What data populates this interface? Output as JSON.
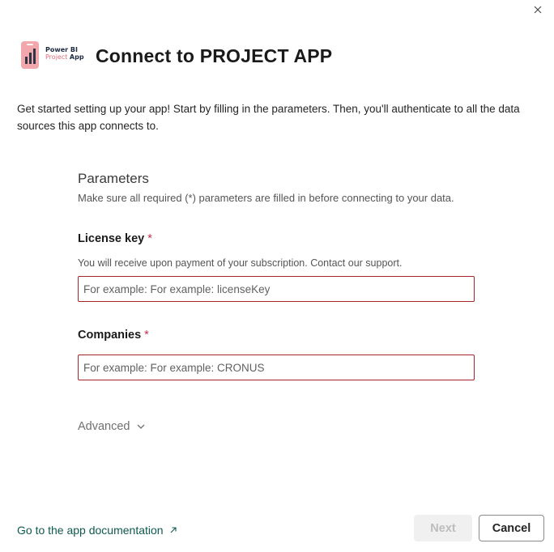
{
  "window": {
    "close_icon": "close-icon"
  },
  "header": {
    "logo_line1": "Power BI",
    "logo_line2_prefix": "Project",
    "logo_line2_suffix": "App",
    "title": "Connect to PROJECT APP"
  },
  "intro": {
    "text": "Get started setting up your app! Start by filling in the parameters. Then, you'll authenticate to all the data sources this app connects to."
  },
  "parameters": {
    "title": "Parameters",
    "description": "Make sure all required (*) parameters are filled in before connecting to your data.",
    "fields": [
      {
        "label": "License key",
        "required_marker": "*",
        "help": "You will receive upon payment of your subscription. Contact our support.",
        "placeholder": "For example: For example: licenseKey",
        "value": ""
      },
      {
        "label": "Companies",
        "required_marker": "*",
        "placeholder": "For example: For example: CRONUS",
        "value": ""
      }
    ],
    "advanced_label": "Advanced"
  },
  "footer": {
    "doc_link": "Go to the app documentation",
    "next_label": "Next",
    "cancel_label": "Cancel"
  },
  "colors": {
    "accent_link": "#0e5a4f",
    "error_border": "#a4262c",
    "required_marker": "#c4314b",
    "logo_pink": "#f2a7ad"
  }
}
